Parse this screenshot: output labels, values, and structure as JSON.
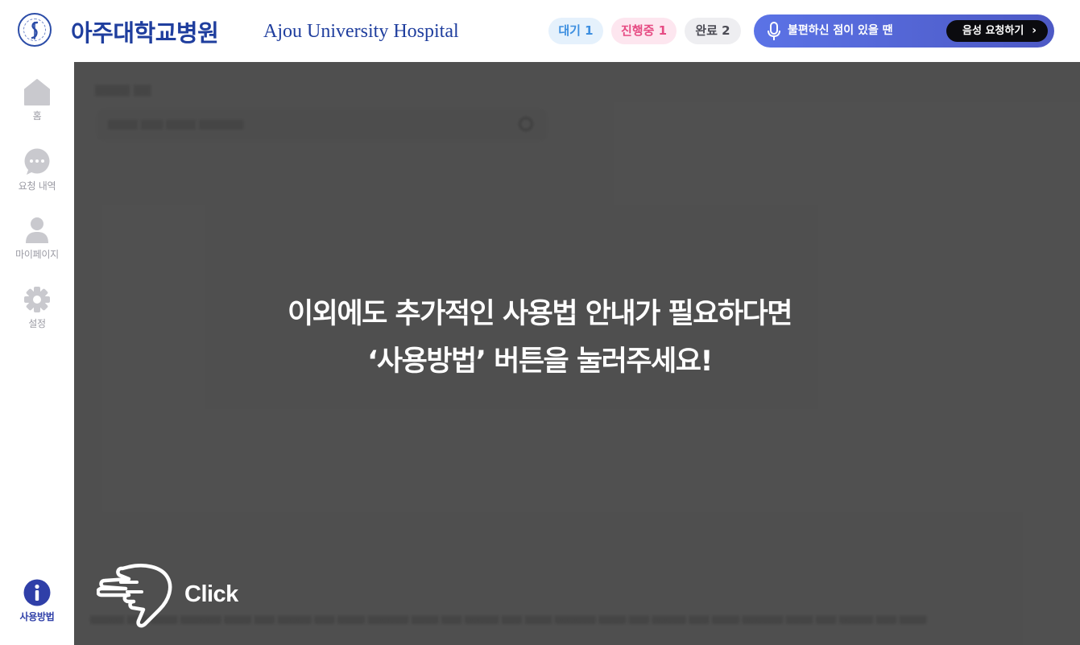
{
  "header": {
    "brand_ko": "아주대학교병원",
    "brand_en": "Ajou University Hospital",
    "status": {
      "waiting": "대기 1",
      "in_progress": "진행중 1",
      "done": "완료 2"
    },
    "voice_bar": {
      "text": "불편하신 점이 있을 땐",
      "button_label": "음성 요청하기",
      "button_chevron": "›"
    }
  },
  "sidebar": {
    "items": [
      {
        "label": "홈",
        "icon": "home-icon"
      },
      {
        "label": "요청 내역",
        "icon": "chat-bubble-icon"
      },
      {
        "label": "마이페이지",
        "icon": "person-icon"
      },
      {
        "label": "설정",
        "icon": "gear-icon"
      }
    ],
    "help": {
      "label": "사용방법",
      "icon": "info-icon"
    }
  },
  "overlay": {
    "line1": "이외에도 추가적인 사용법 안내가 필요하다면",
    "line2": "‘사용방법’ 버튼을 눌러주세요!",
    "click_label": "Click"
  },
  "colors": {
    "brand_blue": "#1f3e9e",
    "wait_text": "#3d8fe0",
    "progress_text": "#e64b83",
    "voice_bar": "#5b73e6",
    "overlay_dim": "#5a5a5a",
    "help_icon": "#2f3fa8"
  }
}
